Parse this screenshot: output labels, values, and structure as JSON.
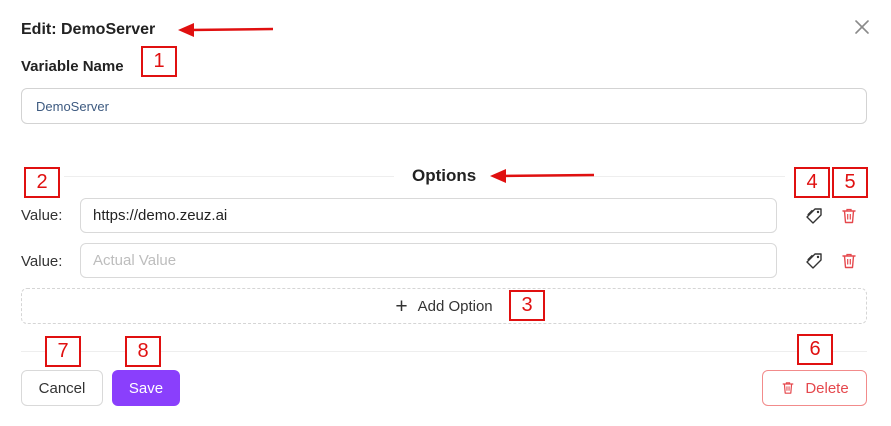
{
  "dialog": {
    "title": "Edit: DemoServer",
    "close_icon": "close-icon"
  },
  "variable": {
    "label": "Variable Name",
    "value": "DemoServer"
  },
  "options": {
    "title": "Options",
    "rows": [
      {
        "label": "Value:",
        "value": "https://demo.zeuz.ai",
        "placeholder": "Actual Value"
      },
      {
        "label": "Value:",
        "value": "",
        "placeholder": "Actual Value"
      }
    ],
    "add_label": "Add Option",
    "row_icons": [
      "tag-icon",
      "trash-icon"
    ]
  },
  "footer": {
    "cancel_label": "Cancel",
    "save_label": "Save",
    "delete_label": "Delete"
  },
  "annotations": [
    "1",
    "2",
    "3",
    "4",
    "5",
    "6",
    "7",
    "8"
  ],
  "colors": {
    "accent": "#8a3ffc",
    "danger": "#e5484d",
    "annotation": "#e01010",
    "input_text": "#3d5a80"
  }
}
